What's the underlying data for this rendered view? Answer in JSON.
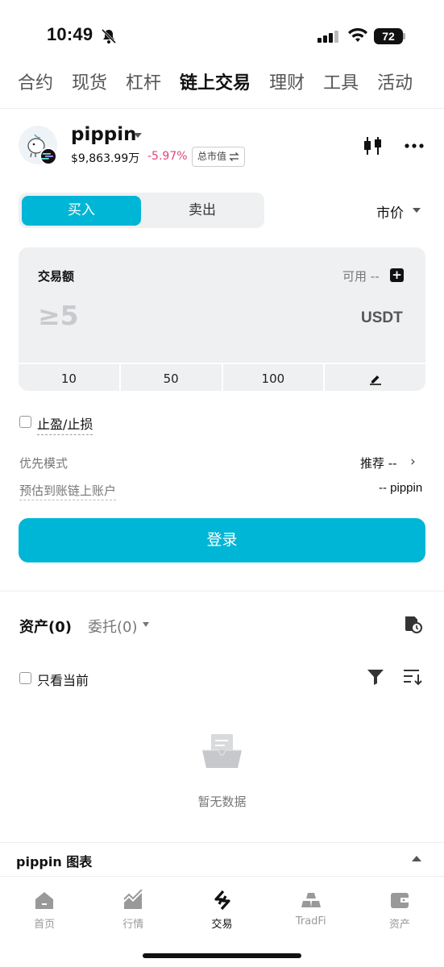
{
  "status_bar": {
    "time": "10:49",
    "battery": "72"
  },
  "top_tabs": [
    {
      "label": "合约",
      "active": false
    },
    {
      "label": "现货",
      "active": false
    },
    {
      "label": "杠杆",
      "active": false
    },
    {
      "label": "链上交易",
      "active": true
    },
    {
      "label": "理财",
      "active": false
    },
    {
      "label": "工具",
      "active": false
    },
    {
      "label": "活动",
      "active": false
    }
  ],
  "token": {
    "name": "pippin",
    "price": "$9,863.99万",
    "change": "-5.97%",
    "mcap_label": "总市值"
  },
  "trade": {
    "buy_label": "买入",
    "sell_label": "卖出",
    "order_type": "市价",
    "amount_label": "交易额",
    "available_label": "可用",
    "available_value": "--",
    "amount_placeholder": "≥5",
    "unit": "USDT",
    "quick_amounts": [
      "10",
      "50",
      "100"
    ],
    "tpsl_label": "止盈/止损",
    "priority_label": "优先模式",
    "priority_value": "推荐 --",
    "estimate_label": "预估到账链上账户",
    "estimate_value": "-- pippin",
    "login_label": "登录"
  },
  "assets": {
    "tab_assets": "资产(0)",
    "tab_orders": "委托(0)",
    "only_current_label": "只看当前",
    "empty_text": "暂无数据"
  },
  "chart_bar": {
    "label": "pippin  图表"
  },
  "bottom_nav": [
    {
      "label": "首页",
      "icon": "home-icon",
      "active": false
    },
    {
      "label": "行情",
      "icon": "market-icon",
      "active": false
    },
    {
      "label": "交易",
      "icon": "trade-icon",
      "active": true
    },
    {
      "label": "TradFi",
      "icon": "tradfi-icon",
      "active": false
    },
    {
      "label": "资产",
      "icon": "wallet-icon",
      "active": false
    }
  ],
  "colors": {
    "accent": "#00b6d6",
    "negative": "#e0447c"
  }
}
